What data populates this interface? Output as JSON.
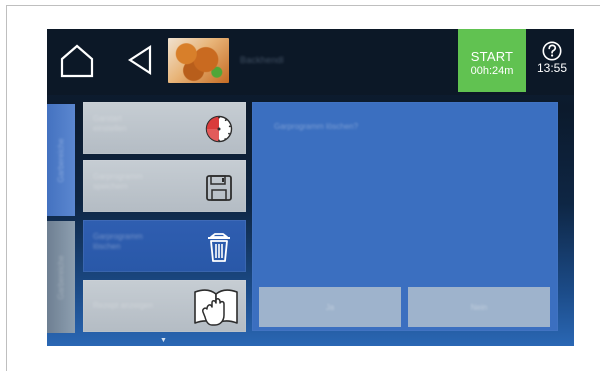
{
  "topbar": {
    "title": "Backhendl",
    "start_label": "START",
    "start_time": "00h:24m",
    "clock": "13:55"
  },
  "sidebar": {
    "tabs": [
      {
        "label": "Garbereiche"
      },
      {
        "label": "Garbereiche"
      }
    ]
  },
  "menu": {
    "items": [
      {
        "label": "Garstart\neinstellen",
        "icon": "timer-icon"
      },
      {
        "label": "Garprogramm\nspeichern",
        "icon": "save-icon"
      },
      {
        "label": "Garprogramm\nlöschen",
        "icon": "trash-icon"
      },
      {
        "label": "Rezept anzeigen",
        "icon": "book-hand-icon"
      }
    ]
  },
  "dialog": {
    "question": "Garprogramm löschen?",
    "yes_label": "Ja",
    "no_label": "Nein"
  },
  "colors": {
    "accent_green": "#61c251",
    "panel_blue": "#3b6fc0",
    "selected_blue": "#2f5eb1",
    "button_gray": "#9eb3cc",
    "card_gray": "#c6cdd3"
  }
}
